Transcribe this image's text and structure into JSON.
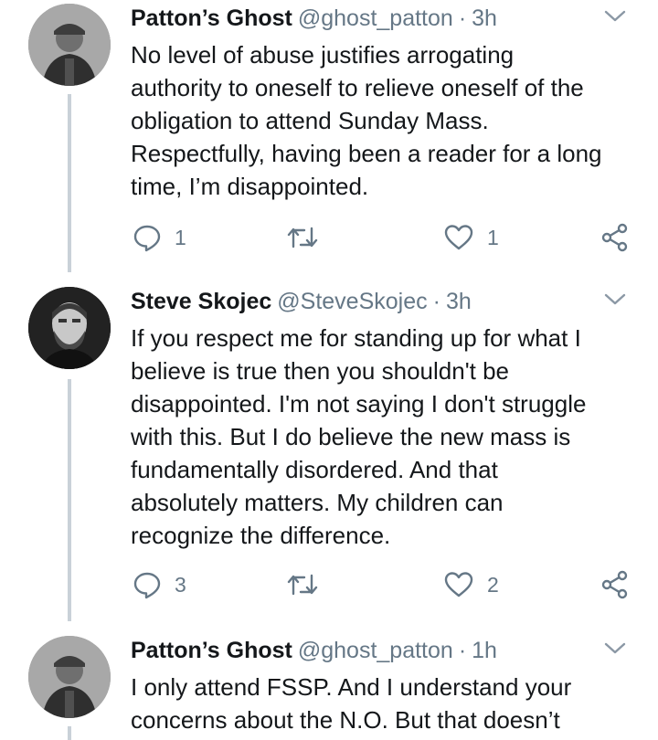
{
  "tweets": [
    {
      "name": "Patton’s Ghost",
      "handle": "@ghost_patton",
      "sep": "·",
      "time": "3h",
      "text": "No level of abuse justifies arrogating\nauthority to oneself to relieve oneself of the\nobligation to attend Sunday Mass.\nRespectfully, having been a reader for a long\ntime, I’m disappointed.",
      "reply_count": "1",
      "retweet_count": "",
      "like_count": "1",
      "avatar": "vintage-soldier-photo"
    },
    {
      "name": "Steve Skojec",
      "handle": "@SteveSkojec",
      "sep": "·",
      "time": "3h",
      "text": "If you respect me for standing up for what I\nbelieve is true then you shouldn't be\ndisappointed. I'm not saying I don't struggle\nwith this. But I do believe the new mass is\nfundamentally disordered. And that\nabsolutely matters. My children can\nrecognize the difference.",
      "reply_count": "3",
      "retweet_count": "",
      "like_count": "2",
      "avatar": "bearded-man-photo"
    },
    {
      "name": "Patton’s Ghost",
      "handle": "@ghost_patton",
      "sep": "·",
      "time": "1h",
      "text": "I only attend FSSP. And I understand your\nconcerns about the N.O. But that doesn’t",
      "avatar": "vintage-soldier-photo"
    }
  ],
  "colors": {
    "text": "#14171a",
    "secondary": "#657786",
    "thread_line": "#c9d1d8",
    "background": "#ffffff"
  },
  "icons": [
    "reply-icon",
    "retweet-icon",
    "like-icon",
    "share-icon",
    "chevron-down-icon"
  ]
}
